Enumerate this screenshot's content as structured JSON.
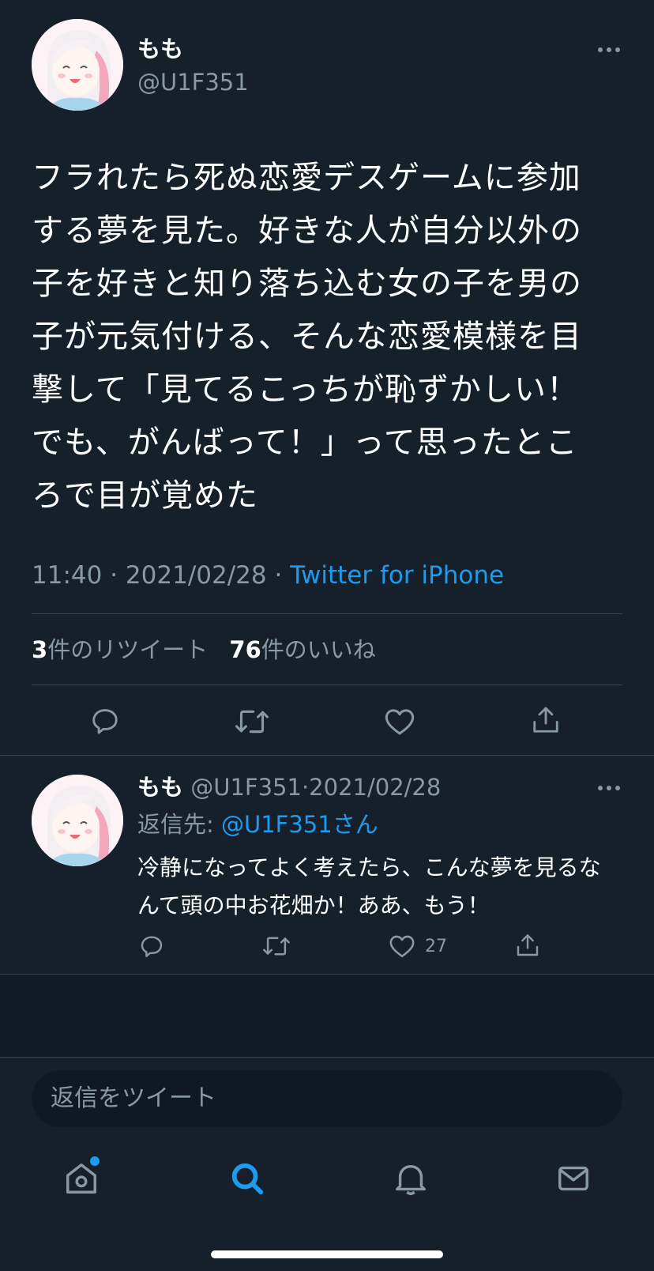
{
  "main_tweet": {
    "display_name": "もも",
    "handle": "@U1F351",
    "text": "フラれたら死ぬ恋愛デスゲームに参加する夢を見た。好きな人が自分以外の子を好きと知り落ち込む女の子を男の子が元気付ける、そんな恋愛模様を目撃して「見てるこっちが恥ずかしい！でも、がんばって！」って思ったところで目が覚めた",
    "time": "11:40",
    "date": "2021/02/28",
    "separator": "·",
    "source": "Twitter for iPhone",
    "retweet_count": "3",
    "retweet_label": "件のリツイート",
    "like_count": "76",
    "like_label": "件のいいね"
  },
  "reply": {
    "display_name": "もも",
    "handle": "@U1F351",
    "date_line": "·2021/02/28",
    "replying_label": "返信先: ",
    "replying_to": "@U1F351さん",
    "text": "冷静になってよく考えたら、こんな夢を見るなんて頭の中お花畑か！ああ、もう！",
    "like_count": "27"
  },
  "composer": {
    "placeholder": "返信をツイート"
  },
  "colors": {
    "background": "#15202b",
    "accent": "#1d9bf0",
    "muted": "#8899a6",
    "divider": "#38444d"
  },
  "icons": [
    "more-icon",
    "reply-icon",
    "retweet-icon",
    "like-icon",
    "share-icon",
    "home-icon",
    "search-icon",
    "notifications-icon",
    "messages-icon"
  ]
}
